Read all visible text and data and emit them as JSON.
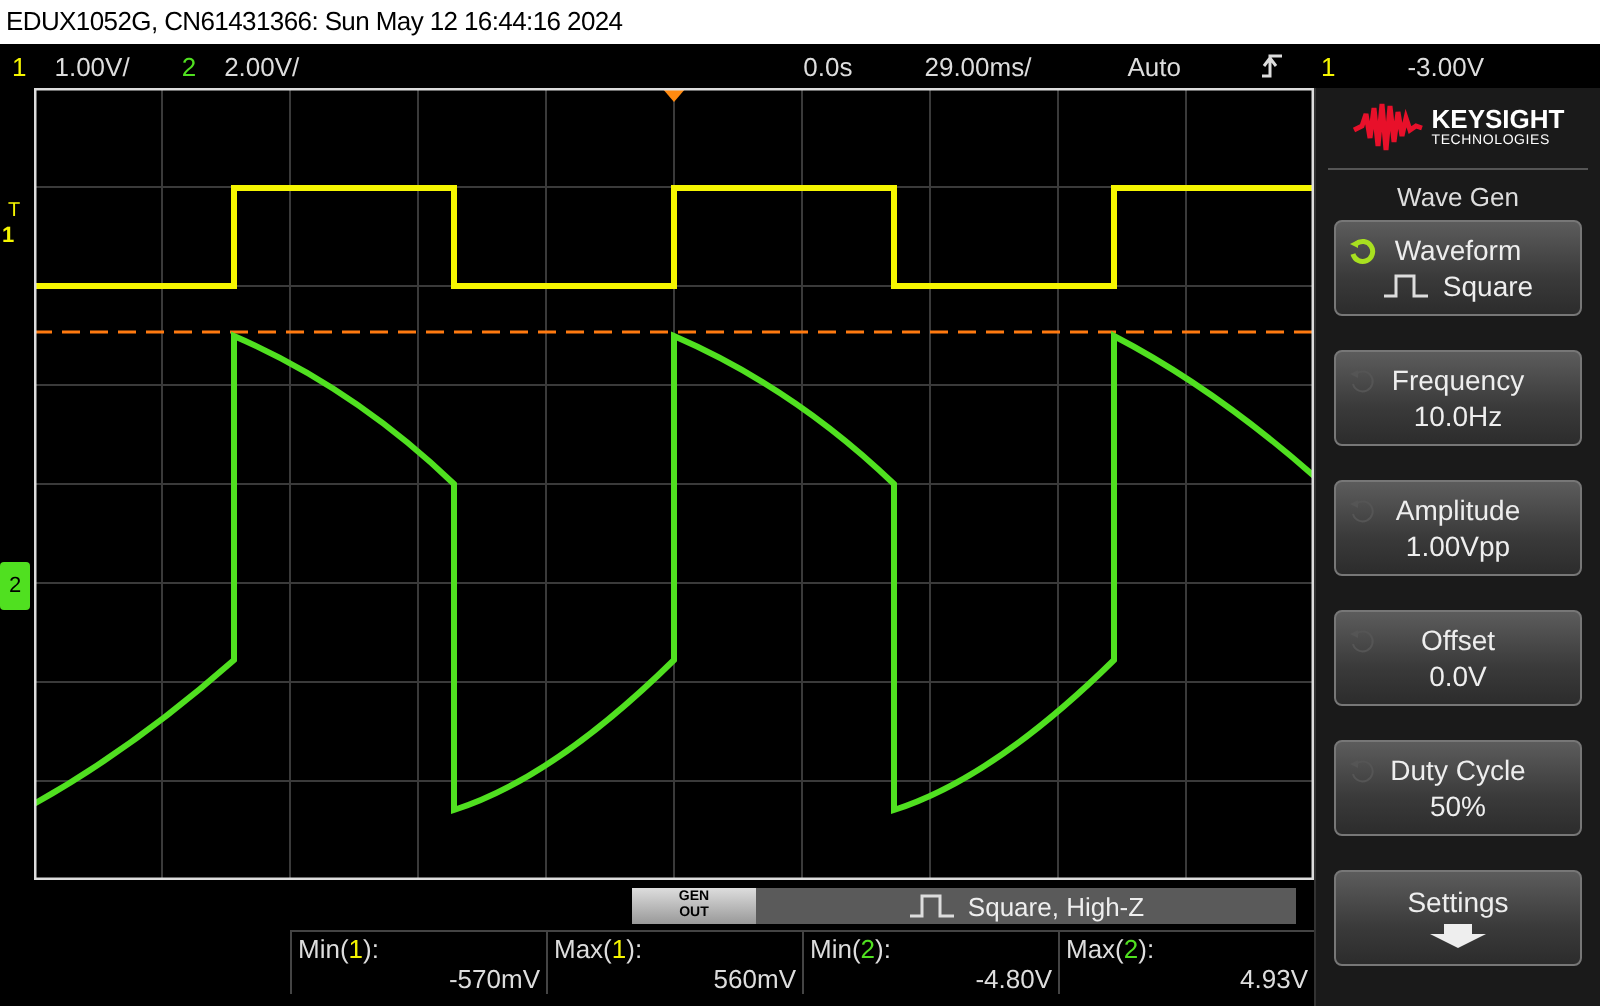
{
  "window": {
    "title": "EDUX1052G, CN61431366: Sun May 12 16:44:16 2024"
  },
  "status_bar": {
    "channels": [
      {
        "number": "1",
        "scale": "1.00V/",
        "color": "#f5f500"
      },
      {
        "number": "2",
        "scale": "2.00V/",
        "color": "#50e020"
      }
    ],
    "time_position": "0.0s",
    "time_scale": "29.00ms/",
    "trigger_mode": "Auto",
    "trigger_source": "1",
    "trigger_level": "-3.00V"
  },
  "screen": {
    "trigger_marker": "T",
    "channel_markers": [
      {
        "number": "1",
        "color": "#f5f500",
        "kind": "outline"
      },
      {
        "number": "2",
        "color": "#50e020",
        "kind": "boxed"
      }
    ]
  },
  "sidebar": {
    "logo": {
      "name": "KEYSIGHT",
      "subtitle": "TECHNOLOGIES"
    },
    "menu_title": "Wave Gen",
    "softkeys": [
      {
        "label": "Waveform",
        "value": "Square",
        "knob_active": true,
        "kind": "square"
      },
      {
        "label": "Frequency",
        "value": "10.0Hz",
        "knob_active": false,
        "kind": "knob"
      },
      {
        "label": "Amplitude",
        "value": "1.00Vpp",
        "knob_active": false,
        "kind": "knob"
      },
      {
        "label": "Offset",
        "value": "0.0V",
        "knob_active": false,
        "kind": "knob"
      },
      {
        "label": "Duty Cycle",
        "value": "50%",
        "knob_active": false,
        "kind": "knob"
      },
      {
        "label": "Settings",
        "kind": "submenu"
      }
    ]
  },
  "gen_out": {
    "line_1": "GEN",
    "line_2": "OUT",
    "banner": "Square, High-Z"
  },
  "measurements": [
    {
      "prefix": "Min(",
      "channel": "1",
      "suffix": "):",
      "value": "-570mV",
      "color": "#f5f500"
    },
    {
      "prefix": "Max(",
      "channel": "1",
      "suffix": "):",
      "value": "560mV",
      "color": "#f5f500"
    },
    {
      "prefix": "Min(",
      "channel": "2",
      "suffix": "):",
      "value": "-4.80V",
      "color": "#50e020"
    },
    {
      "prefix": "Max(",
      "channel": "2",
      "suffix": "):",
      "value": "4.93V",
      "color": "#50e020"
    }
  ]
}
